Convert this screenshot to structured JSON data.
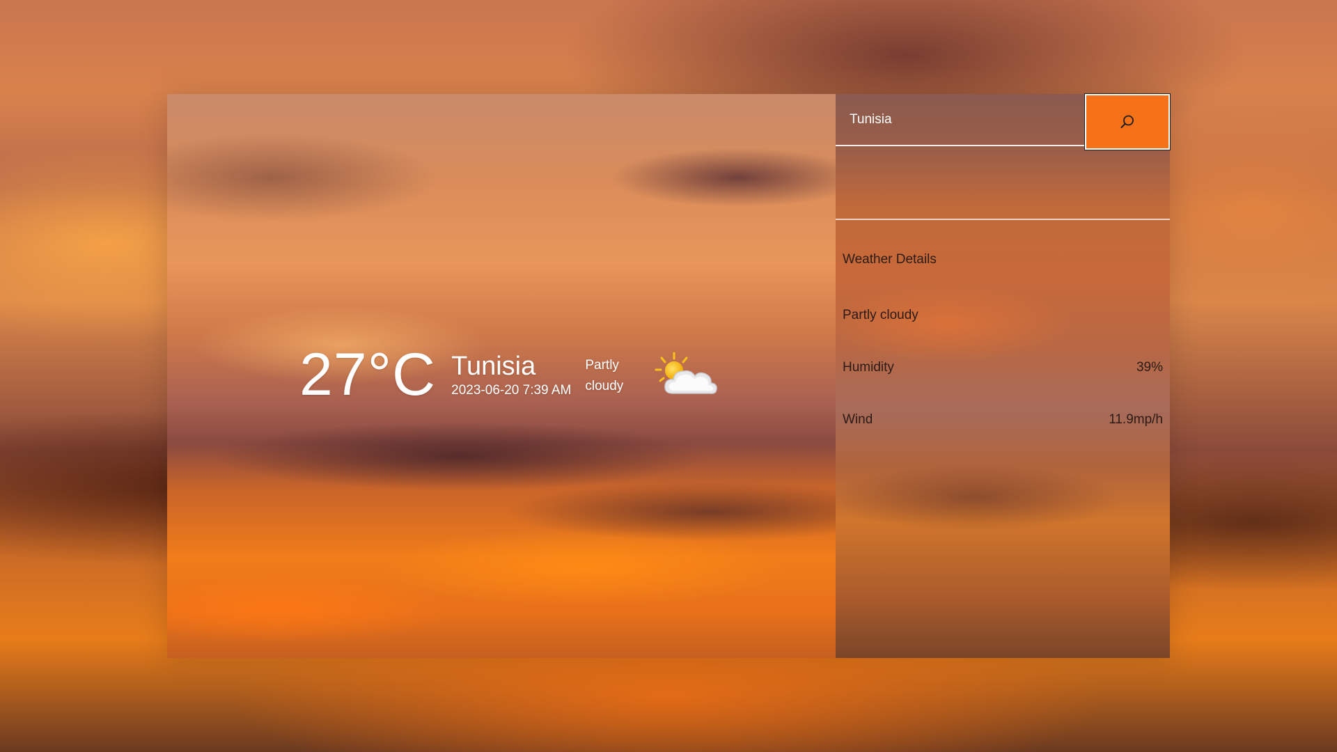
{
  "current": {
    "temperature": "27°C",
    "city": "Tunisia",
    "datetime": "2023-06-20 7:39 AM",
    "condition_line1": "Partly",
    "condition_line2": "cloudy",
    "icon": "partly-cloudy-icon"
  },
  "search": {
    "value": "Tunisia",
    "icon": "search-icon",
    "button_color": "#f57218"
  },
  "details": {
    "title": "Weather Details",
    "condition": "Partly cloudy",
    "rows": [
      {
        "label": "Humidity",
        "value": "39%"
      },
      {
        "label": "Wind",
        "value": "11.9mp/h"
      }
    ]
  }
}
